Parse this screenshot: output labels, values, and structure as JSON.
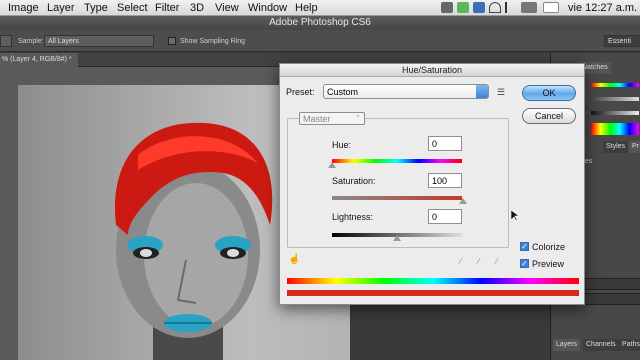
{
  "menubar": {
    "items": [
      "Image",
      "Layer",
      "Type",
      "Select",
      "Filter",
      "3D",
      "View",
      "Window",
      "Help"
    ],
    "clock": "vie 12:27 a.m."
  },
  "app_title": "Adobe Photoshop CS6",
  "options_bar": {
    "sample_label": "Sample:",
    "sample_value": "All Layers",
    "show_ring_label": "Show Sampling Ring",
    "workspace": "Essenti"
  },
  "document_tab": "% (Layer 4, RGB/8#) *",
  "panels": {
    "swatches_tab": "watches",
    "styles_tab": "Styles",
    "pr_tab": "Pr",
    "rtles_label": "rtles",
    "layers_tab": "Layers",
    "channels_tab": "Channels",
    "paths_tab": "Paths"
  },
  "dialog": {
    "title": "Hue/Saturation",
    "preset_label": "Preset:",
    "preset_value": "Custom",
    "channel_value": "Master",
    "hue_label": "Hue:",
    "hue_value": "0",
    "saturation_label": "Saturation:",
    "saturation_value": "100",
    "lightness_label": "Lightness:",
    "lightness_value": "0",
    "ok_label": "OK",
    "cancel_label": "Cancel",
    "colorize_label": "Colorize",
    "colorize_checked": true,
    "preview_label": "Preview",
    "preview_checked": true
  }
}
